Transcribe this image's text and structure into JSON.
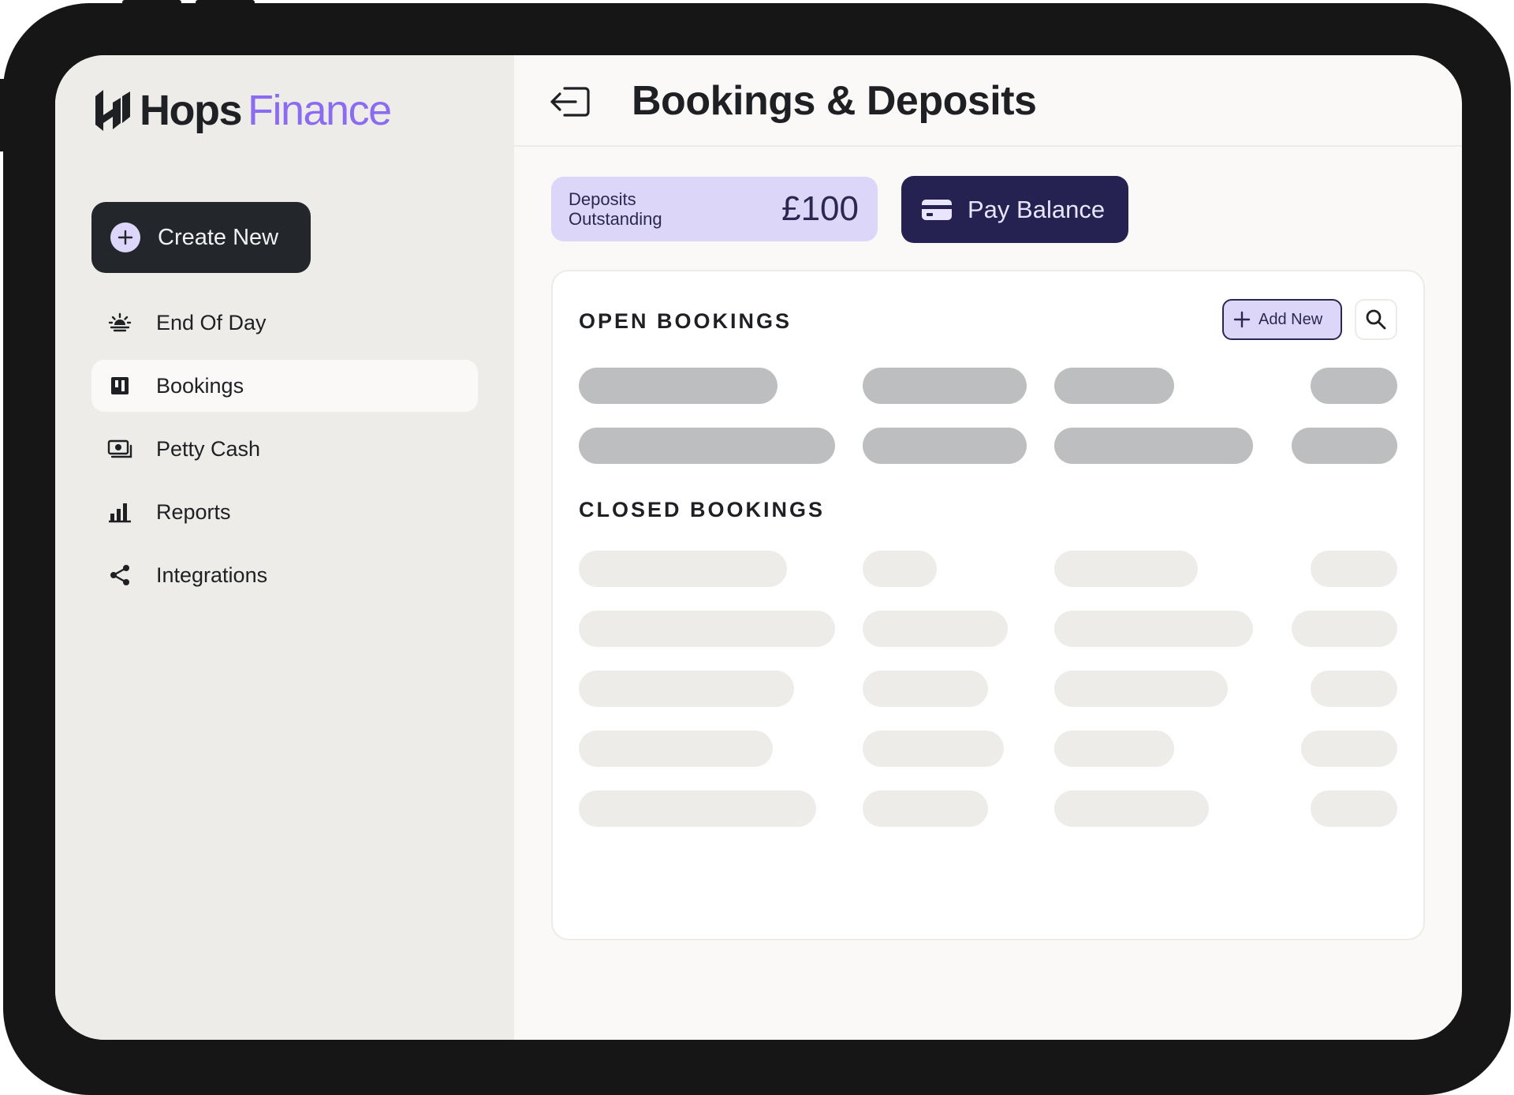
{
  "brand": {
    "name_part1": "Hops",
    "name_part2": "Finance",
    "accent": "#8b6cf0"
  },
  "sidebar": {
    "create_button": {
      "label": "Create New",
      "icon": "plus-circle-icon"
    },
    "items": [
      {
        "label": "End Of Day",
        "icon": "sunset-icon",
        "active": false
      },
      {
        "label": "Bookings",
        "icon": "bookings-icon",
        "active": true
      },
      {
        "label": "Petty Cash",
        "icon": "cash-icon",
        "active": false
      },
      {
        "label": "Reports",
        "icon": "bar-chart-icon",
        "active": false
      },
      {
        "label": "Integrations",
        "icon": "share-icon",
        "active": false
      }
    ]
  },
  "header": {
    "title": "Bookings & Deposits",
    "back_icon": "log-out-icon"
  },
  "summary": {
    "deposits_label": "Deposits Outstanding",
    "deposits_amount": "£100",
    "pay_button_label": "Pay Balance",
    "pay_button_icon": "credit-card-icon"
  },
  "open_bookings": {
    "title": "OPEN BOOKINGS",
    "add_button_label": "Add New",
    "rows_loading": 2
  },
  "closed_bookings": {
    "title": "CLOSED BOOKINGS",
    "rows_loading": 5
  },
  "colors": {
    "sidebar_bg": "#edece9",
    "main_bg": "#faf9f7",
    "dark_button": "#23262b",
    "deposits_bg": "#dcd6f8",
    "pay_button_bg": "#252150",
    "skeleton_dark": "#bdbebf",
    "skeleton_light": "#edece9"
  }
}
